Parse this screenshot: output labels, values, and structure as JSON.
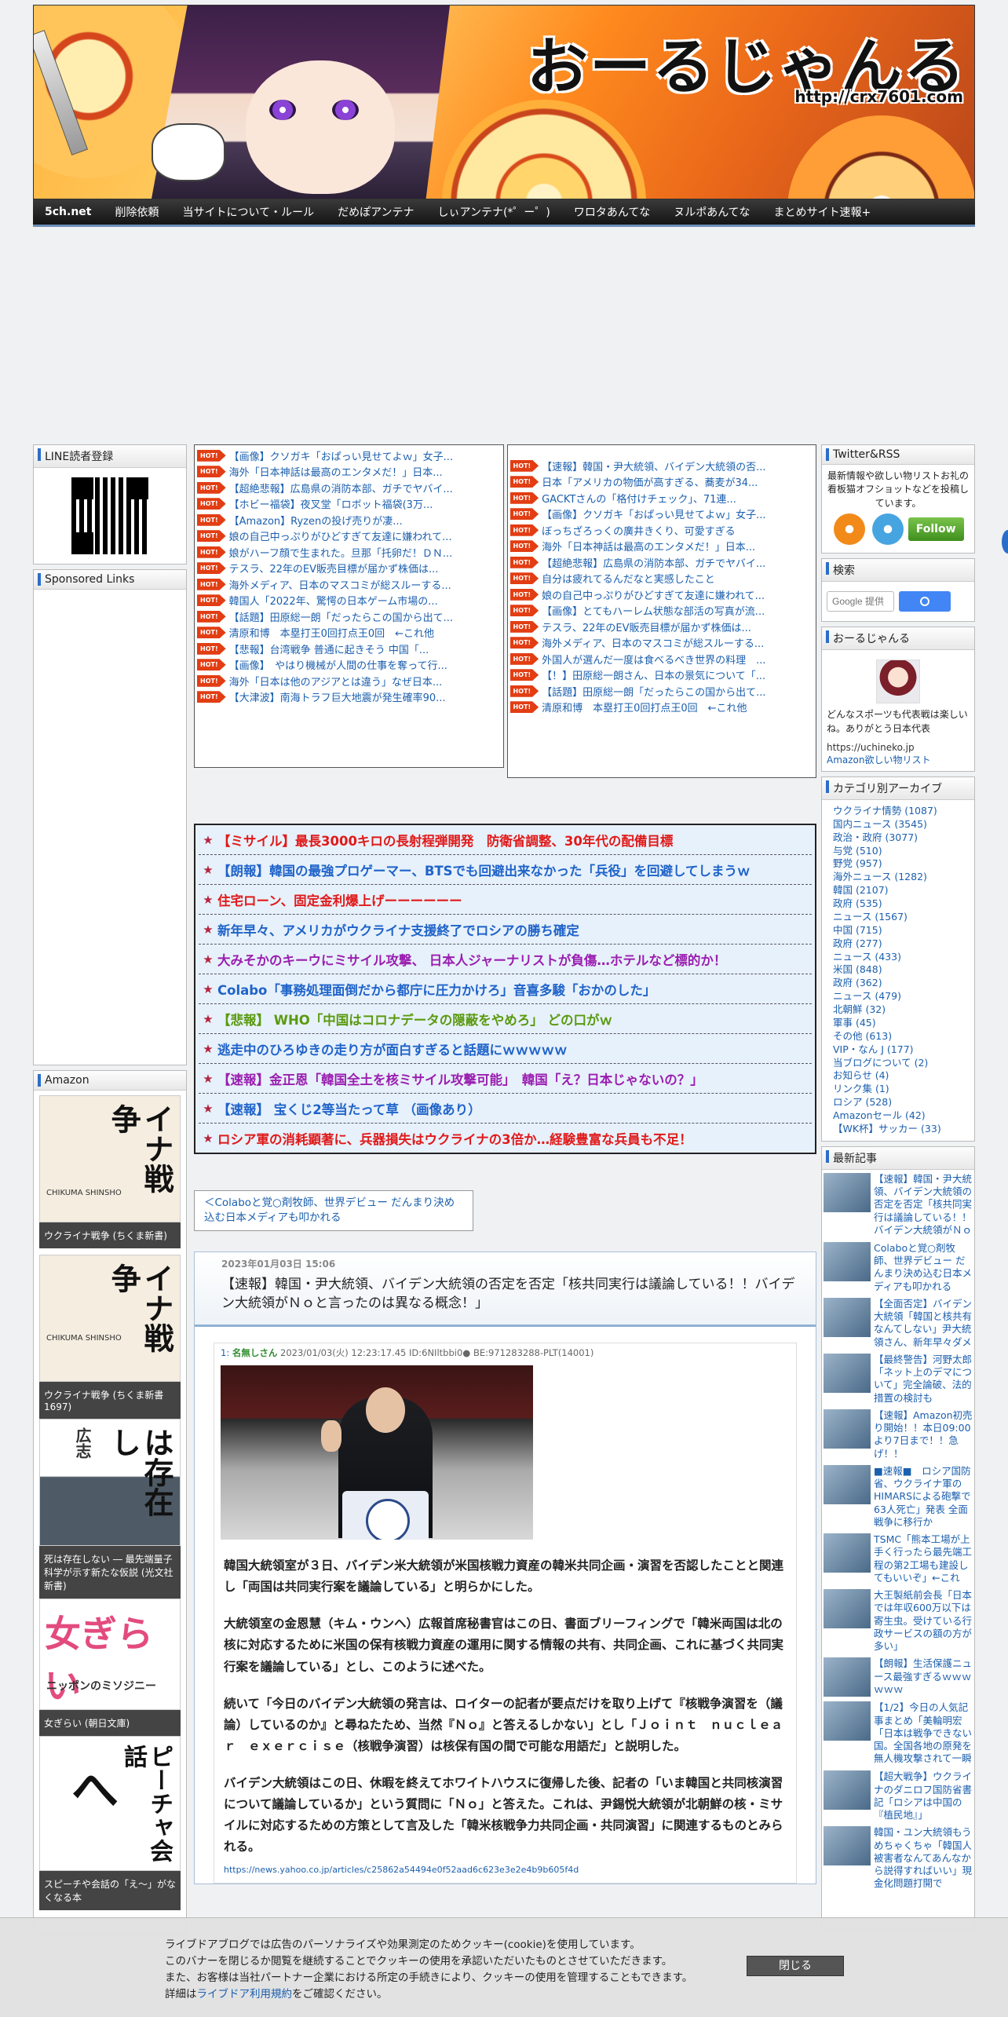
{
  "site": {
    "title": "おーるじゃんる",
    "url": "http://crx7601.com"
  },
  "nav": [
    "5ch.net",
    "削除依頼",
    "当サイトについて・ルール",
    "だめぽアンテナ",
    "しぃアンテナ(*゜ー゜)",
    "ワロタあんてな",
    "ヌルポあんてな",
    "まとめサイト速報+"
  ],
  "left": {
    "line_title": "LINE読者登録",
    "sponsored_title": "Sponsored Links",
    "amazon_title": "Amazon",
    "books": [
      {
        "cover": "イナ戦争",
        "publisher": "CHIKUMA SHINSHO",
        "caption": "ウクライナ戦争 (ちくま新書)"
      },
      {
        "cover": "イナ戦争",
        "publisher": "CHIKUMA SHINSHO",
        "caption": "ウクライナ戦争 (ちくま新書 1697)"
      },
      {
        "cover": "は存在し",
        "publisher": "広志",
        "caption": "死は存在しない ― 最先端量子科学が示す新たな仮説 (光文社新書)"
      },
      {
        "cover": "女ぎらい",
        "publisher": "ニッポンのミソジニー",
        "caption": "女ぎらい (朝日文庫)"
      },
      {
        "cover": "ピーチャ会話",
        "publisher": "",
        "caption": "スピーチや会話の「え〜」がなくなる本"
      }
    ]
  },
  "hot_left": [
    "【画像】クソガキ「おぱっい見せてよｗ」女子...",
    "海外「日本神話は最高のエンタメだ！」日本...",
    "【超絶悲報】広島県の消防本部、ガチでヤバイ...",
    "【ホビー福袋】夜叉堂「ロボット福袋(3万...",
    "【Amazon】Ryzenの投げ売りが凄...",
    "娘の自己中っぷりがひどすぎて友達に嫌われて...",
    "娘がハーフ顔で生まれた。旦那「托卵だ！ＤＮ...",
    "テスラ、22年のEV販売目標が届かず株価は...",
    "海外メディア、日本のマスコミが総スルーする...",
    "韓国人「2022年、驚愕の日本ゲーム市場の...",
    "【話題】田原総一朗「だったらこの国から出て...",
    "清原和博　本塁打王0回打点王0回　←これ他",
    "【悲報】台湾戦争 普通に起きそう 中国「...",
    "【画像】　やはり機械が人間の仕事を奪って行...",
    "海外「日本は他のアジアとは違う」なぜ日本...",
    "【大津波】南海トラフ巨大地震が発生確率90..."
  ],
  "hot_right": [
    "【速報】韓国・尹大統領、バイデン大統領の否...",
    "日本「アメリカの物価が高すぎる、蕎麦が34...",
    "GACKTさんの「格付けチェック」、71連...",
    "【画像】クソガキ「おぱっい見せてよｗ」女子...",
    "ぼっちざろっくの廣井きくり、可愛すぎる",
    "海外「日本神話は最高のエンタメだ！」日本...",
    "【超絶悲報】広島県の消防本部、ガチでヤバイ...",
    "自分は疲れてるんだなと実感したこと",
    "娘の自己中っぷりがひどすぎて友達に嫌われて...",
    "【画像】とてもハーレム状態な部活の写真が流...",
    "テスラ、22年のEV販売目標が届かず株価は...",
    "海外メディア、日本のマスコミが総スルーする...",
    "外国人が選んだ一度は食べるべき世界の料理　...",
    "【！】田原総一朗さん、日本の景気について「...",
    "【話題】田原総一朗「だったらこの国から出て...",
    "清原和博　本塁打王0回打点王0回　←これ他"
  ],
  "headlines": [
    {
      "text": "【ミサイル】最長3000キロの長射程弾開発　防衛省調整、30年代の配備目標",
      "color": "#e01a1a"
    },
    {
      "text": "【朗報】韓国の最強プロゲーマー、BTSでも回避出来なかった「兵役」を回避してしまうｗ",
      "color": "#1f63c9"
    },
    {
      "text": "住宅ローン、固定金利爆上げーーーーーー",
      "color": "#e01a1a"
    },
    {
      "text": "新年早々、アメリカがウクライナ支援終了でロシアの勝ち確定",
      "color": "#1f63c9"
    },
    {
      "text": "大みそかのキーウにミサイル攻撃、 日本人ジャーナリストが負傷…ホテルなど標的か！",
      "color": "#9a1fb0"
    },
    {
      "text": "Colabo「事務処理面倒だから都庁に圧力かけろ」音喜多駿「おかのした」",
      "color": "#1f63c9"
    },
    {
      "text": "【悲報】 WHO「中国はコロナデータの隠蔽をやめろ」 どの口がｗ",
      "color": "#5a9a10"
    },
    {
      "text": "逃走中のひろゆきの走り方が面白すぎると話題にｗｗｗｗｗ",
      "color": "#1f63c9"
    },
    {
      "text": "【速報】金正恩「韓国全土を核ミサイル攻撃可能」　韓国「え？日本じゃないの？」",
      "color": "#9a1fb0"
    },
    {
      "text": "【速報】 宝くじ2等当たって草 （画像あり）",
      "color": "#1f63c9"
    },
    {
      "text": "ロシア軍の消耗顕著に、兵器損失はウクライナの3倍か…経験豊富な兵員も不足！",
      "color": "#e01a1a"
    }
  ],
  "prev_link": "＜Colaboと覚○剤牧師、世界デビュー だんまり決め込む日本メディアも叩かれる",
  "article": {
    "date": "2023年01月03日 15:06",
    "title": "【速報】韓国・尹大統領、バイデン大統領の否定を否定「核共同実行は議論している！！バイデン大統領がＮｏと言ったのは異なる概念！」",
    "post_num": "1:",
    "post_name": "名無しさん",
    "post_meta": "2023/01/03(火) 12:23:17.45 ID:6NIltbbi0● BE:971283288-PLT(14001)",
    "paragraphs": [
      "韓国大統領室が３日、バイデン米大統領が米国核戦力資産の韓米共同企画・演習を否認したことと関連し「両国は共同実行案を議論している」と明らかにした。",
      "大統領室の金恩慧（キム・ウンヘ）広報首席秘書官はこの日、書面ブリーフィングで「韓米両国は北の核に対応するために米国の保有核戦力資産の運用に関する情報の共有、共同企画、これに基づく共同実行案を議論している」とし、このように述べた。",
      "続いて「今日のバイデン大統領の発言は、ロイターの記者が要点だけを取り上げて『核戦争演習を（議論）しているのか』と尋ねたため、当然『Ｎｏ』と答えるしかない」とし「Ｊｏｉｎｔ　ｎｕｃｌｅａｒ　ｅｘｅｒｃｉｓｅ（核戦争演習）は核保有国の間で可能な用語だ」と説明した。",
      "バイデン大統領はこの日、休暇を終えてホワイトハウスに復帰した後、記者の「いま韓国と共同核演習について議論しているか」という質問に「Ｎｏ」と答えた。これは、尹錫悦大統領が北朝鮮の核・ミサイルに対応するための方策として言及した「韓米核戦争力共同企画・共同演習」に関連するものとみられる。"
    ],
    "source": "https://news.yahoo.co.jp/articles/c25862a54494e0f52aad6c623e3e2e4b9b605f4d"
  },
  "right": {
    "twitter_title": "Twitter&RSS",
    "twitter_desc": "最新情報や欲しい物リストお礼の看板猫オフショットなどを投稿しています。",
    "follow_label": "Follow",
    "search_title": "検索",
    "search_placeholder": "Google 提供",
    "profile_title": "おーるじゃんる",
    "profile_desc": "どんなスポーツも代表戦は楽しいね。ありがとう日本代表",
    "profile_link1": "https://uchineko.jp",
    "profile_link2": "Amazon欲しい物リスト",
    "category_title": "カテゴリ別アーカイブ",
    "categories": [
      "ウクライナ情勢 (1087)",
      "国内ニュース (3545)",
      "政治・政府 (3077)",
      "与党 (510)",
      "野党 (957)",
      "海外ニュース (1282)",
      "韓国 (2107)",
      "政府 (535)",
      "ニュース (1567)",
      "中国 (715)",
      "政府 (277)",
      "ニュース (433)",
      "米国 (848)",
      "政府 (362)",
      "ニュース (479)",
      "北朝鮮 (32)",
      "軍事 (45)",
      "その他 (613)",
      "VIP・なん J (177)",
      "当ブログについて (2)",
      "お知らせ (4)",
      "リンク集 (1)",
      "ロシア (528)",
      "Amazonセール (42)",
      "【WK杯】サッカー (33)"
    ],
    "recent_title": "最新記事",
    "recent": [
      "【速報】韓国・尹大統領、バイデン大統領の否定を否定「核共同実行は議論している！！バイデン大統領がＮｏと言ったのは異なる概念！」",
      "Colaboと覚○剤牧師、世界デビュー だんまり決め込む日本メディアも叩かれる",
      "【全面否定】バイデン大統領「韓国と核共有なんてしない」尹大統領さん、新年早々ダメ",
      "【最終警告】河野太郎「ネット上のデマについて」完全論破、法的措置の検討も",
      "【速報】Amazon初売り開始！！本日09:00より7日まで！！急げ！！",
      "■速報■　ロシア国防省、ウクライナ軍のHIMARSによる砲撃で63人死亡」発表 全面戦争に移行か",
      "TSMC「熊本工場が上手く行ったら最先端工程の第2工場も建設してもいいぞ」←これ",
      "大王製紙前会長「日本では年収600万以下は寄生虫。受けている行政サービスの額の方が多い」",
      "【朗報】生活保護ニュース最強すぎるｗｗｗｗｗｗ",
      "【1/2】今日の人気記事まとめ「美輪明宏「日本は戦争できない国。全国各地の原発を無人機攻撃されて一瞬で終わる」ほか",
      "【超大戦争】ウクライナのダニロフ国防省書記「ロシアは中国の『植民地』」",
      "韓国・ユン大統領もうめちゃくちゃ「韓国人被害者なんてあんなから説得すればいい」現金化問題打開で"
    ]
  },
  "cookie": {
    "lines": [
      "ライブドアブログでは広告のパーソナライズや効果測定のためクッキー(cookie)を使用しています。",
      "このバナーを閉じるか閲覧を継続することでクッキーの使用を承認いただいたものとさせていただきます。",
      "また、お客様は当社パートナー企業における所定の手続きにより、クッキーの使用を管理することもできます。"
    ],
    "last_prefix": "詳細は",
    "link": "ライブドア利用規約",
    "last_suffix": "をご確認ください。",
    "close": "閉じる"
  }
}
